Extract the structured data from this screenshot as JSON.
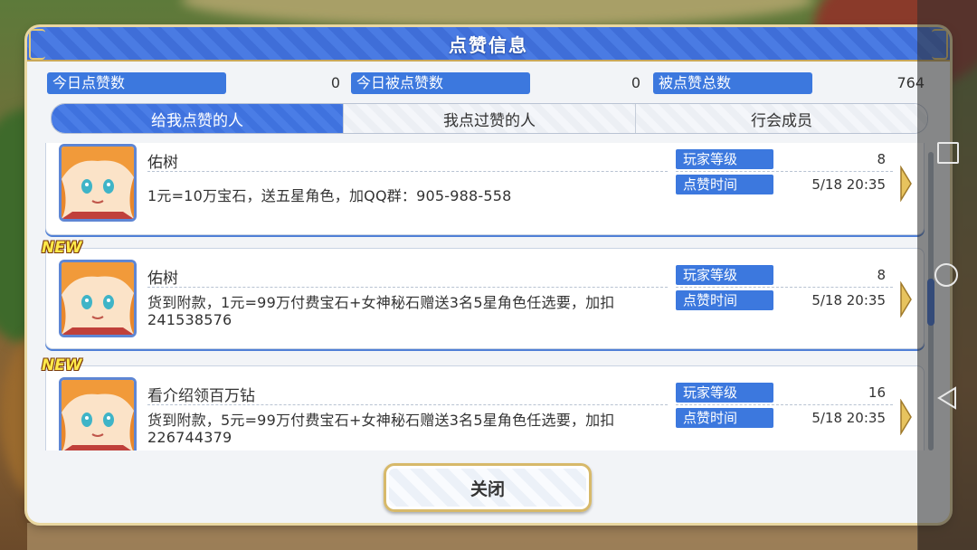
{
  "dialog": {
    "title": "点赞信息",
    "close_label": "关闭"
  },
  "stats": [
    {
      "label": "今日点赞数",
      "value": "0"
    },
    {
      "label": "今日被点赞数",
      "value": "0"
    },
    {
      "label": "被点赞总数",
      "value": "764"
    }
  ],
  "tabs": [
    {
      "label": "给我点赞的人",
      "active": true
    },
    {
      "label": "我点过赞的人",
      "active": false
    },
    {
      "label": "行会成员",
      "active": false
    }
  ],
  "badge_new": "NEW",
  "field_labels": {
    "level": "玩家等级",
    "time": "点赞时间"
  },
  "entries": [
    {
      "name": "佑树",
      "message": "1元=10万宝石，送五星角色，加QQ群：905-988-558",
      "level": "8",
      "time": "5/18 20:35",
      "is_new": false
    },
    {
      "name": "佑树",
      "message": "货到附款，1元=99万付费宝石+女神秘石赠送3名5星角色任选要，加扣241538576",
      "level": "8",
      "time": "5/18 20:35",
      "is_new": true
    },
    {
      "name": "看介绍领百万钻",
      "message": "货到附款，5元=99万付费宝石+女神秘石赠送3名5星角色任选要，加扣226744379",
      "level": "16",
      "time": "5/18 20:35",
      "is_new": true
    }
  ],
  "colors": {
    "accent": "#3c78de",
    "gold": "#d7b96a",
    "panel": "#f2f4f7"
  }
}
